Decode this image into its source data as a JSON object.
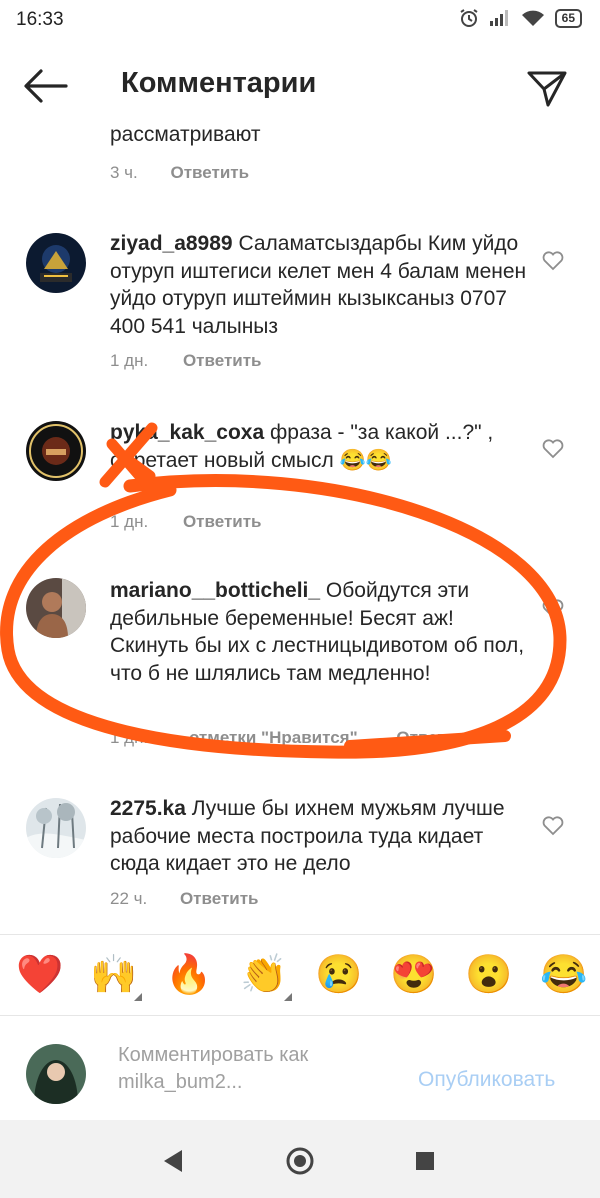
{
  "status_bar": {
    "time": "16:33",
    "battery": "65"
  },
  "header": {
    "title": "Комментарии"
  },
  "comments": [
    {
      "text": "рассматривают",
      "time": "3 ч.",
      "reply": "Ответить"
    },
    {
      "username": "ziyad_a8989",
      "text": "Саламатсыздарбы Ким уйдо отуруп иштегиси келет мен 4 балам менен уйдо отуруп иштеймин кызыксаныз 0707 400 541 чалыныз",
      "time": "1 дн.",
      "reply": "Ответить"
    },
    {
      "username": "pyka_kak_coxa",
      "text": "фраза - \"за какой ...?\" , обретает новый смысл",
      "emoji": "😂😂",
      "time": "1 дн.",
      "reply": "Ответить"
    },
    {
      "username": "mariano__botticheli_",
      "text": "Обойдутся эти дебильные беременные! Бесят аж! Скинуть бы их с лестницыдивотом об пол, что б не шлялись там медленно!",
      "time": "1 дн.",
      "likes": "отметки \"Нравится\"",
      "reply": "Ответить"
    },
    {
      "username": "2275.ka",
      "text": "Лучше бы ихнем мужьям лучше рабочие места построила туда кидает сюда кидает это не дело",
      "time": "22 ч.",
      "reply": "Ответить"
    }
  ],
  "emoji_bar": [
    "❤️",
    "🙌",
    "🔥",
    "👏",
    "😢",
    "😍",
    "😮",
    "😂"
  ],
  "compose": {
    "placeholder": "Комментировать как milka_bum2...",
    "publish_label": "Опубликовать"
  },
  "colors": {
    "accent": "#a9cef4",
    "annotation": "#ff5a14",
    "meta_gray": "#8e8e8e"
  }
}
